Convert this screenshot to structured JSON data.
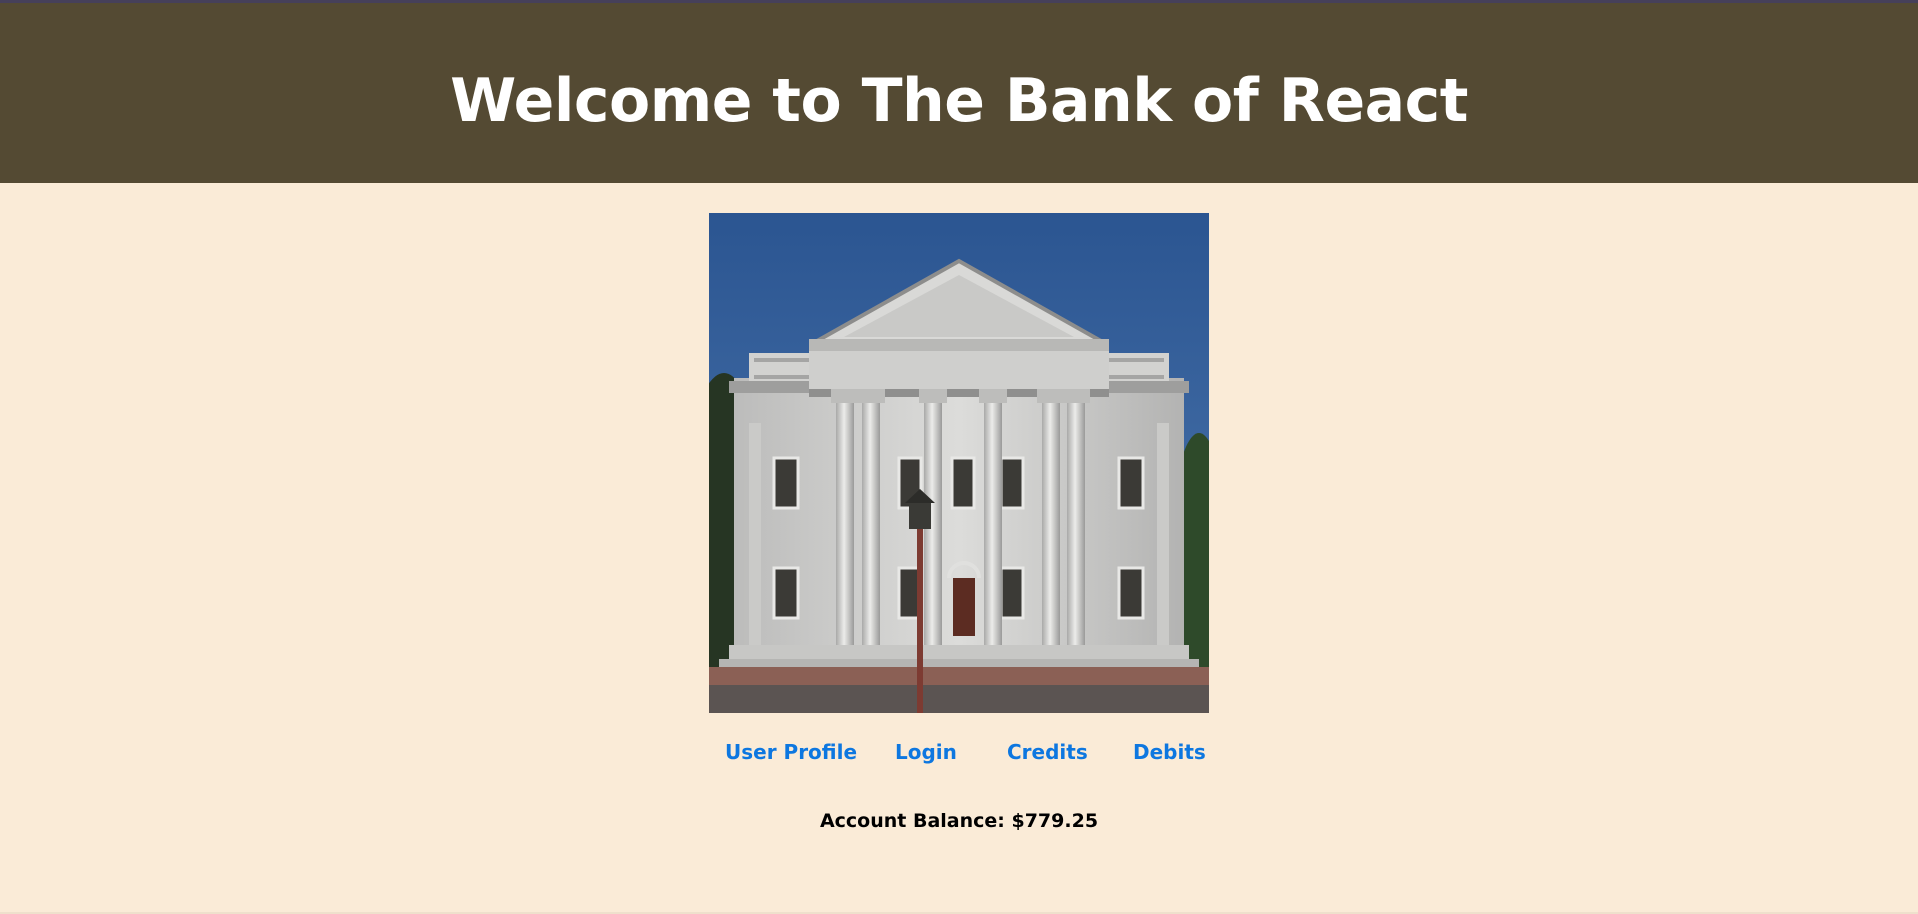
{
  "header": {
    "title": "Welcome to The Bank of React",
    "background_color": "#544a33",
    "text_color": "#ffffff"
  },
  "hero_image": {
    "icon": "bank-building-image"
  },
  "nav": {
    "items": [
      {
        "label": "User Profile"
      },
      {
        "label": "Login"
      },
      {
        "label": "Credits"
      },
      {
        "label": "Debits"
      }
    ],
    "link_color": "#0d77e0"
  },
  "account": {
    "balance_label": "Account Balance: $779.25"
  },
  "page": {
    "background_color": "#faebd7"
  }
}
